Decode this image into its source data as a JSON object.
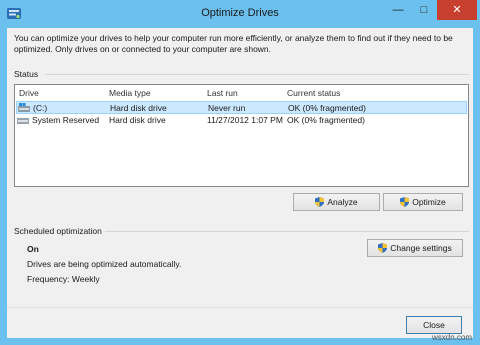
{
  "window": {
    "title": "Optimize Drives",
    "minimize_glyph": "—",
    "maximize_glyph": "□",
    "close_glyph": "✕",
    "title_bar_color": "#6cc0ee",
    "close_button_color": "#c7402f"
  },
  "description": "You can optimize your drives to help your computer run more efficiently, or analyze them to find out if they need to be optimized. Only drives on or connected to your computer are shown.",
  "status": {
    "label": "Status",
    "columns": [
      "Drive",
      "Media type",
      "Last run",
      "Current status"
    ],
    "rows": [
      {
        "drive": "(C:)",
        "media_type": "Hard disk drive",
        "last_run": "Never run",
        "current_status": "OK (0% fragmented)",
        "selected": true,
        "icon": "windows-drive-icon"
      },
      {
        "drive": "System Reserved",
        "media_type": "Hard disk drive",
        "last_run": "11/27/2012 1:07 PM",
        "current_status": "OK (0% fragmented)",
        "selected": false,
        "icon": "hard-drive-icon"
      }
    ],
    "selection_color": "#cce8ff"
  },
  "buttons": {
    "analyze": "Analyze",
    "optimize": "Optimize",
    "change_settings": "Change settings",
    "close": "Close"
  },
  "scheduled": {
    "label": "Scheduled optimization",
    "state": "On",
    "message": "Drives are being optimized automatically.",
    "frequency": "Frequency: Weekly"
  },
  "watermark": "wsxdn.com"
}
